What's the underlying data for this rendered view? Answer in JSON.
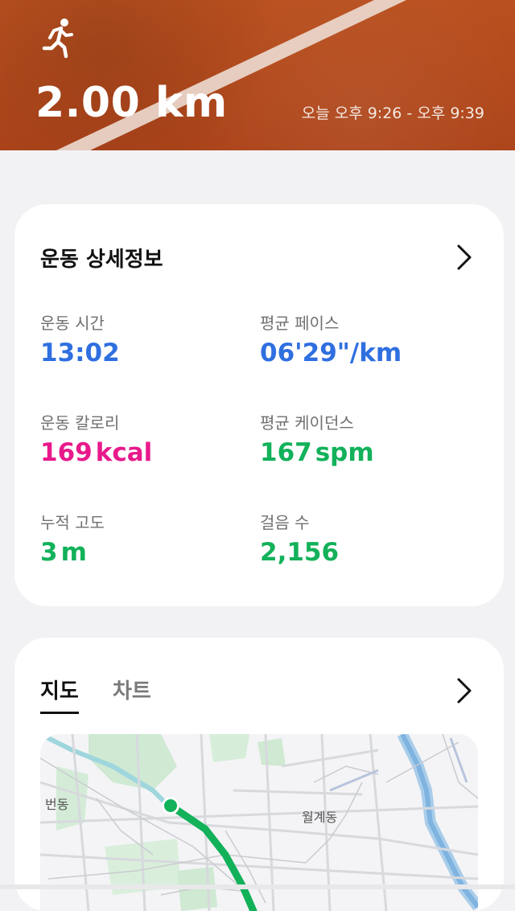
{
  "header": {
    "activity_icon": "running-person-icon",
    "distance": "2.00 km",
    "time_range": "오늘 오후 9:26 - 오후 9:39",
    "background_color": "#b84a1d"
  },
  "details": {
    "title": "운동 상세정보",
    "metrics": [
      {
        "label": "운동 시간",
        "value": "13:02",
        "unit": "",
        "color": "#2f6fe0"
      },
      {
        "label": "평균 페이스",
        "value": "06'29\"/km",
        "unit": "",
        "color": "#2f6fe0"
      },
      {
        "label": "운동 칼로리",
        "value": "169",
        "unit": "kcal",
        "color": "#e8198b"
      },
      {
        "label": "평균 케이던스",
        "value": "167",
        "unit": "spm",
        "color": "#12b15a"
      },
      {
        "label": "누적 고도",
        "value": "3",
        "unit": "m",
        "color": "#12b15a"
      },
      {
        "label": "걸음 수",
        "value": "2,156",
        "unit": "",
        "color": "#12b15a"
      }
    ]
  },
  "map_section": {
    "tabs": [
      {
        "label": "지도",
        "active": true
      },
      {
        "label": "차트",
        "active": false
      }
    ],
    "map_labels": {
      "left": "번동",
      "right": "월계동"
    },
    "route_color": "#12b15a"
  }
}
